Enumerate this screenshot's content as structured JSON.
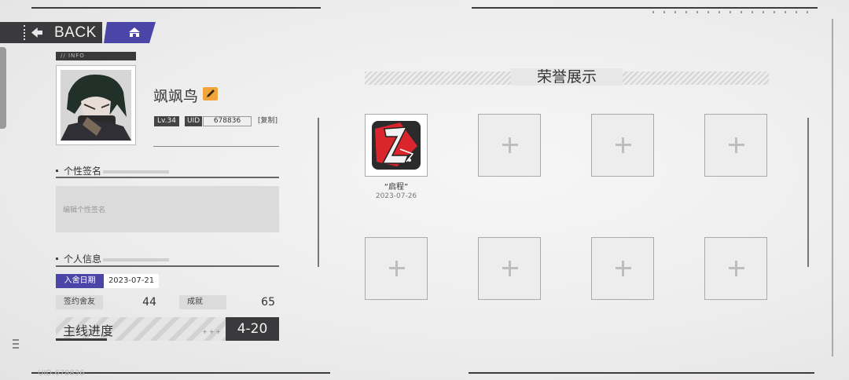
{
  "nav": {
    "back_label": "BACK"
  },
  "info": {
    "tag": "// INFO",
    "name": "飒飒鸟",
    "level": "Lv.34",
    "uid_label": "UID",
    "uid_value": "678836",
    "copy_label": "[复制]"
  },
  "signature": {
    "title": "个性签名",
    "placeholder": "编辑个性签名"
  },
  "personal": {
    "title": "个人信息",
    "join_label": "入舍日期",
    "join_date": "2023-07-21",
    "friends_label": "签约舍友",
    "friends_value": "44",
    "achievements_label": "成就",
    "achievements_value": "65",
    "progress_label": "主线进度",
    "progress_value": "4-20",
    "progress_fraction": 0.3
  },
  "honor": {
    "title": "荣誉展示",
    "badges": [
      {
        "name": "“启程”",
        "date": "2023-07-26"
      }
    ]
  },
  "footer": {
    "uid_text": "UID:678836"
  },
  "colors": {
    "accent": "#4b45a8",
    "dark": "#3a3a3c",
    "badge_red": "#d9252b",
    "pencil": "#f0a43a"
  }
}
